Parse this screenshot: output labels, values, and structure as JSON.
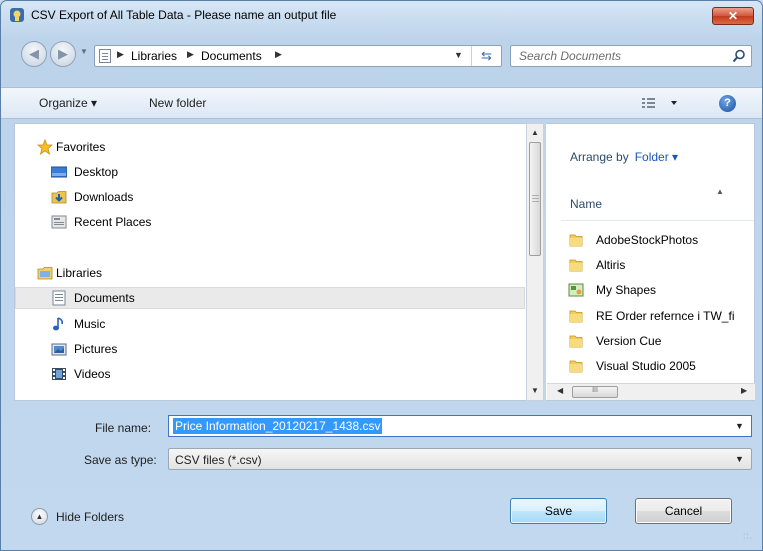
{
  "window": {
    "title": "CSV Export of All Table Data - Please name an output file",
    "close_glyph": "✕"
  },
  "address": {
    "crumbs": [
      "Libraries",
      "Documents"
    ],
    "search_placeholder": "Search Documents"
  },
  "toolbar": {
    "organize_label": "Organize ▾",
    "new_folder_label": "New folder",
    "help_glyph": "?"
  },
  "nav": {
    "favorites_header": "Favorites",
    "favorites": [
      "Desktop",
      "Downloads",
      "Recent Places"
    ],
    "libraries_header": "Libraries",
    "libraries": [
      "Documents",
      "Music",
      "Pictures",
      "Videos"
    ],
    "selected": "Documents"
  },
  "files": {
    "arrange_label": "Arrange by",
    "arrange_value": "Folder ▾",
    "column_name": "Name",
    "items": [
      {
        "name": "AdobeStockPhotos",
        "icon": "folder-icon"
      },
      {
        "name": "Altiris",
        "icon": "folder-icon"
      },
      {
        "name": "My Shapes",
        "icon": "shapes-folder-icon"
      },
      {
        "name": "RE Order refernce i TW_fi",
        "icon": "folder-icon"
      },
      {
        "name": "Version Cue",
        "icon": "folder-icon"
      },
      {
        "name": "Visual Studio 2005",
        "icon": "folder-icon"
      }
    ]
  },
  "form": {
    "file_name_label": "File name:",
    "file_name_value": "Price Information_20120217_1438.csv",
    "save_type_label": "Save as type:",
    "save_type_value": "CSV files (*.csv)"
  },
  "footer": {
    "hide_folders_label": "Hide Folders",
    "save_label": "Save",
    "cancel_label": "Cancel"
  },
  "colors": {
    "selection": "#3399ff",
    "folder_yellow": "#f2cd5a",
    "link_blue": "#1a55b8"
  }
}
